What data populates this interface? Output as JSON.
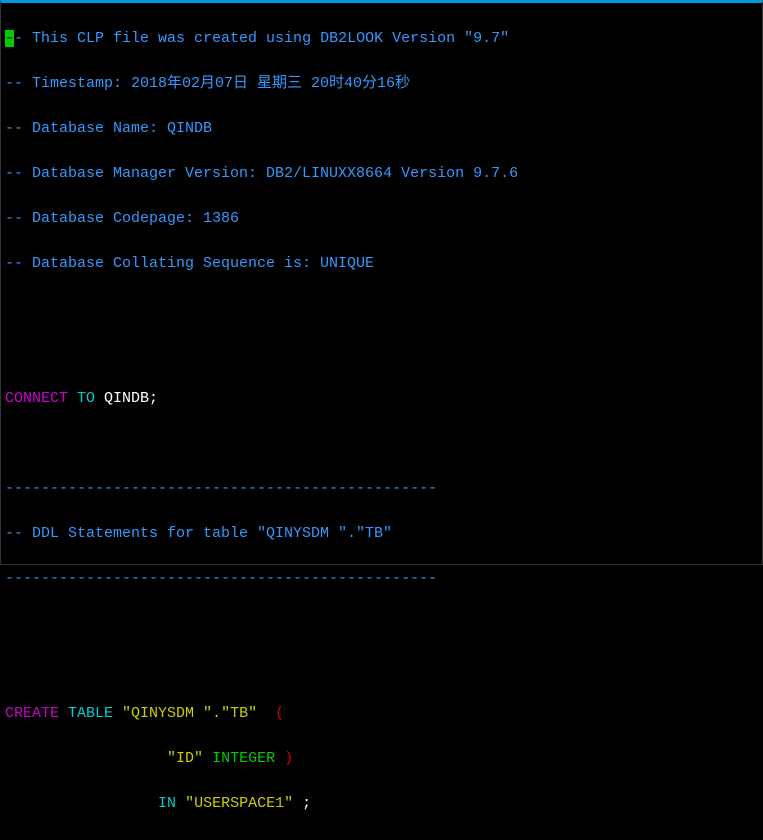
{
  "line1": {
    "cursor": "-",
    "rest": "- This CLP file was created using DB2LOOK Version \"9.7\""
  },
  "line2": "-- Timestamp: 2018年02月07日 星期三 20时40分16秒",
  "line3": "-- Database Name: QINDB",
  "line4": "-- Database Manager Version: DB2/LINUXX8664 Version 9.7.6",
  "line5": "-- Database Codepage: 1386",
  "line6": "-- Database Collating Sequence is: UNIQUE",
  "line9": {
    "connect": "CONNECT",
    "to": "TO",
    "db": " QINDB;"
  },
  "line11": "------------------------------------------------",
  "line12": "-- DDL Statements for table \"QINYSDM \".\"TB\"",
  "line13": "------------------------------------------------",
  "line16": {
    "create": "CREATE",
    "table": "TABLE",
    "name": " \"QINYSDM \".\"TB\"  ",
    "paren": "("
  },
  "line17": {
    "indent": "                  ",
    "col": "\"ID\"",
    "sp": " ",
    "type": "INTEGER",
    "sp2": " ",
    "paren": ")"
  },
  "line18": {
    "indent": "                 ",
    "in": "IN",
    "sp": " ",
    "ts": "\"USERSPACE1\"",
    "semi": " ;"
  }
}
